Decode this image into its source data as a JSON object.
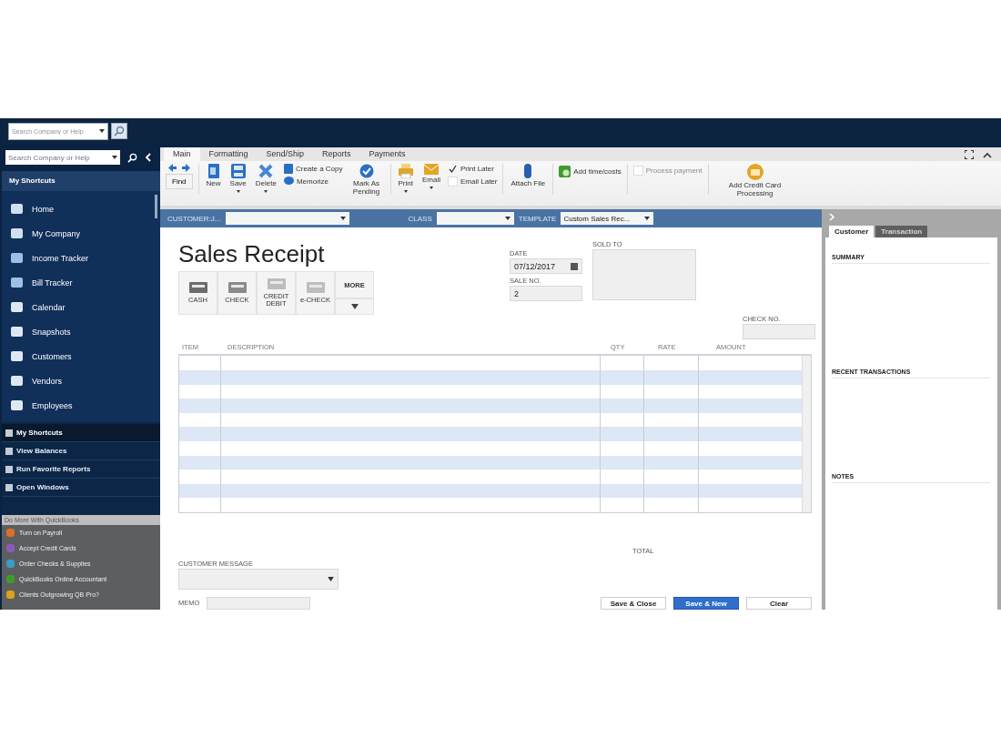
{
  "top_search": {
    "placeholder": "Search Company or Help"
  },
  "sidebar": {
    "search": {
      "placeholder": "Search Company or Help"
    },
    "heading": "My Shortcuts",
    "items": [
      {
        "label": "Home"
      },
      {
        "label": "My Company"
      },
      {
        "label": "Income Tracker"
      },
      {
        "label": "Bill Tracker"
      },
      {
        "label": "Calendar"
      },
      {
        "label": "Snapshots"
      },
      {
        "label": "Customers"
      },
      {
        "label": "Vendors"
      },
      {
        "label": "Employees"
      }
    ],
    "sections": [
      {
        "label": "My Shortcuts",
        "selected": true
      },
      {
        "label": "View Balances",
        "selected": false
      },
      {
        "label": "Run Favorite Reports",
        "selected": false
      },
      {
        "label": "Open Windows",
        "selected": false
      }
    ],
    "more_heading": "Do More With QuickBooks",
    "more_items": [
      {
        "label": "Turn on Payroll",
        "color": "#d8702a"
      },
      {
        "label": "Accept Credit Cards",
        "color": "#8a5bb8"
      },
      {
        "label": "Order Checks & Supplies",
        "color": "#3a9bc4"
      },
      {
        "label": "QuickBooks Online Accountant",
        "color": "#3f9a2c"
      },
      {
        "label": "Clients Outgrowing QB Pro?",
        "color": "#d9a21c"
      }
    ]
  },
  "ribbon": {
    "tabs": [
      {
        "label": "Main",
        "selected": true
      },
      {
        "label": "Formatting",
        "selected": false
      },
      {
        "label": "Send/Ship",
        "selected": false
      },
      {
        "label": "Reports",
        "selected": false
      },
      {
        "label": "Payments",
        "selected": false
      }
    ],
    "find": "Find",
    "new": "New",
    "save": "Save",
    "delete": "Delete",
    "create_copy": "Create a Copy",
    "memorize": "Memorize",
    "mark_pending": "Mark As Pending",
    "print": "Print",
    "email": "Email",
    "print_later": {
      "label": "Print Later",
      "checked": true
    },
    "email_later": {
      "label": "Email Later",
      "checked": false
    },
    "attach": "Attach File",
    "add_time": "Add time/costs",
    "process_payment": {
      "label": "Process payment",
      "disabled": true
    },
    "add_cc": "Add Credit Card Processing"
  },
  "header_bar": {
    "customer_label": "CUSTOMER:J...",
    "class_label": "CLASS",
    "template_label": "TEMPLATE",
    "template_value": "Custom Sales Rec..."
  },
  "form": {
    "title": "Sales Receipt",
    "payment_methods": [
      "CASH",
      "CHECK",
      "CREDIT DEBIT",
      "e-CHECK"
    ],
    "more": "MORE",
    "date_label": "DATE",
    "date": "07/12/2017",
    "sale_no_label": "SALE NO.",
    "sale_no": "2",
    "sold_to_label": "SOLD TO",
    "check_no_label": "CHECK NO.",
    "columns": [
      "ITEM",
      "DESCRIPTION",
      "QTY",
      "RATE",
      "AMOUNT"
    ],
    "total_label": "TOTAL",
    "customer_message_label": "CUSTOMER MESSAGE",
    "memo_label": "MEMO",
    "buttons": [
      {
        "label": "Save & Close",
        "primary": false
      },
      {
        "label": "Save & New",
        "primary": true
      },
      {
        "label": "Clear",
        "primary": false
      }
    ]
  },
  "right_panel": {
    "tabs": [
      {
        "label": "Customer",
        "selected": true
      },
      {
        "label": "Transaction",
        "selected": false
      }
    ],
    "sections": [
      "SUMMARY",
      "RECENT TRANSACTIONS",
      "NOTES"
    ]
  }
}
